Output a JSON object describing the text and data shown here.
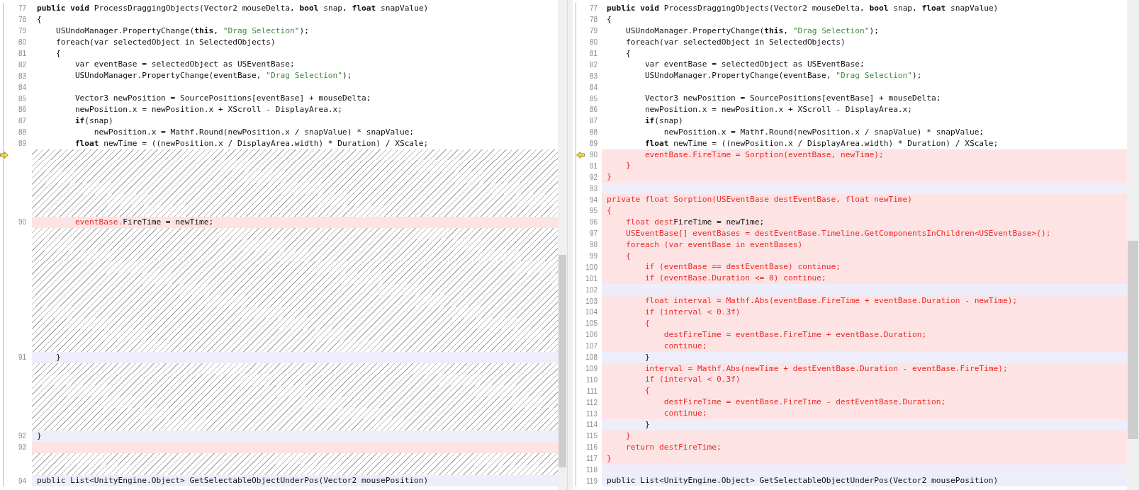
{
  "panes": [
    {
      "rows": [
        {
          "number": "77",
          "kind": "same",
          "current": false,
          "parts": [
            {
              "kind": "keyword",
              "text": "public void"
            },
            {
              "kind": "plain",
              "text": " ProcessDraggingObjects(Vector2 mouseDelta, "
            },
            {
              "kind": "keyword",
              "text": "bool"
            },
            {
              "kind": "plain",
              "text": " snap, "
            },
            {
              "kind": "keyword",
              "text": "float"
            },
            {
              "kind": "plain",
              "text": " snapValue)"
            }
          ]
        },
        {
          "number": "78",
          "kind": "same",
          "current": false,
          "parts": [
            {
              "kind": "plain",
              "text": "{"
            }
          ]
        },
        {
          "number": "79",
          "kind": "same",
          "current": false,
          "parts": [
            {
              "kind": "plain",
              "text": "    USUndoManager.PropertyChange("
            },
            {
              "kind": "keyword",
              "text": "this"
            },
            {
              "kind": "plain",
              "text": ", "
            },
            {
              "kind": "string",
              "text": "\"Drag Selection\""
            },
            {
              "kind": "plain",
              "text": ");"
            }
          ]
        },
        {
          "number": "80",
          "kind": "same",
          "current": false,
          "parts": [
            {
              "kind": "plain",
              "text": "    foreach(var selectedObject in SelectedObjects)"
            }
          ]
        },
        {
          "number": "81",
          "kind": "same",
          "current": false,
          "parts": [
            {
              "kind": "plain",
              "text": "    {"
            }
          ]
        },
        {
          "number": "82",
          "kind": "same",
          "current": false,
          "parts": [
            {
              "kind": "plain",
              "text": "        var eventBase = selectedObject as USEventBase;"
            }
          ]
        },
        {
          "number": "83",
          "kind": "same",
          "current": false,
          "parts": [
            {
              "kind": "plain",
              "text": "        USUndoManager.PropertyChange(eventBase, "
            },
            {
              "kind": "string",
              "text": "\"Drag Selection\""
            },
            {
              "kind": "plain",
              "text": ");"
            }
          ]
        },
        {
          "number": "84",
          "kind": "same",
          "current": false
        },
        {
          "number": "85",
          "kind": "same",
          "current": false,
          "parts": [
            {
              "kind": "plain",
              "text": "        Vector3 newPosition = SourcePositions[eventBase] + mouseDelta;"
            }
          ]
        },
        {
          "number": "86",
          "kind": "same",
          "current": false,
          "parts": [
            {
              "kind": "plain",
              "text": "        newPosition.x = newPosition.x + XScroll - DisplayArea.x;"
            }
          ]
        },
        {
          "number": "87",
          "kind": "same",
          "current": false,
          "parts": [
            {
              "kind": "keyword",
              "text": "        if"
            },
            {
              "kind": "plain",
              "text": "(snap)"
            }
          ]
        },
        {
          "number": "88",
          "kind": "same",
          "current": false,
          "parts": [
            {
              "kind": "plain",
              "text": "            newPosition.x = Mathf.Round(newPosition.x / snapValue) * snapValue;"
            }
          ]
        },
        {
          "number": "89",
          "kind": "same",
          "current": false,
          "parts": [
            {
              "kind": "keyword",
              "text": "        float"
            },
            {
              "kind": "plain",
              "text": " newTime = ((newPosition.x / DisplayArea.width) * Duration) / XScale;"
            }
          ]
        },
        {
          "kind": "filler",
          "current": true
        },
        {
          "kind": "filler",
          "current": false
        },
        {
          "kind": "filler",
          "current": false
        },
        {
          "kind": "filler",
          "current": false
        },
        {
          "kind": "filler",
          "current": false
        },
        {
          "kind": "filler",
          "current": false
        },
        {
          "number": "90",
          "kind": "changed",
          "current": false,
          "parts": [
            {
              "kind": "changed",
              "text": "        eventBase."
            },
            {
              "kind": "plain",
              "text": "FireTime = newTime;"
            }
          ]
        },
        {
          "kind": "filler",
          "current": false
        },
        {
          "kind": "filler",
          "current": false
        },
        {
          "kind": "filler",
          "current": false
        },
        {
          "kind": "filler",
          "current": false
        },
        {
          "kind": "filler",
          "current": false
        },
        {
          "kind": "filler",
          "current": false
        },
        {
          "kind": "filler",
          "current": false
        },
        {
          "kind": "filler",
          "current": false
        },
        {
          "kind": "filler",
          "current": false
        },
        {
          "kind": "filler",
          "current": false
        },
        {
          "kind": "filler",
          "current": false
        },
        {
          "number": "91",
          "kind": "moved",
          "current": false,
          "parts": [
            {
              "kind": "plain",
              "text": "    }"
            }
          ]
        },
        {
          "kind": "filler",
          "current": false
        },
        {
          "kind": "filler",
          "current": false
        },
        {
          "kind": "filler",
          "current": false
        },
        {
          "kind": "filler",
          "current": false
        },
        {
          "kind": "filler",
          "current": false
        },
        {
          "kind": "filler",
          "current": false
        },
        {
          "number": "92",
          "kind": "moved",
          "current": false,
          "parts": [
            {
              "kind": "plain",
              "text": "}"
            }
          ]
        },
        {
          "number": "93",
          "kind": "changed",
          "current": false
        },
        {
          "kind": "filler",
          "current": false
        },
        {
          "kind": "filler",
          "current": false
        },
        {
          "number": "94",
          "kind": "moved",
          "current": false,
          "parts": [
            {
              "kind": "plain",
              "text": "public List<UnityEngine.Object> GetSelectableObjectUnderPos(Vector2 mousePosition)"
            }
          ]
        }
      ]
    },
    {
      "rows": [
        {
          "number": "77",
          "kind": "same",
          "current": false,
          "parts": [
            {
              "kind": "keyword",
              "text": "public void"
            },
            {
              "kind": "plain",
              "text": " ProcessDraggingObjects(Vector2 mouseDelta, "
            },
            {
              "kind": "keyword",
              "text": "bool"
            },
            {
              "kind": "plain",
              "text": " snap, "
            },
            {
              "kind": "keyword",
              "text": "float"
            },
            {
              "kind": "plain",
              "text": " snapValue)"
            }
          ]
        },
        {
          "number": "78",
          "kind": "same",
          "current": false,
          "parts": [
            {
              "kind": "plain",
              "text": "{"
            }
          ]
        },
        {
          "number": "79",
          "kind": "same",
          "current": false,
          "parts": [
            {
              "kind": "plain",
              "text": "    USUndoManager.PropertyChange("
            },
            {
              "kind": "keyword",
              "text": "this"
            },
            {
              "kind": "plain",
              "text": ", "
            },
            {
              "kind": "string",
              "text": "\"Drag Selection\""
            },
            {
              "kind": "plain",
              "text": ");"
            }
          ]
        },
        {
          "number": "80",
          "kind": "same",
          "current": false,
          "parts": [
            {
              "kind": "plain",
              "text": "    foreach(var selectedObject in SelectedObjects)"
            }
          ]
        },
        {
          "number": "81",
          "kind": "same",
          "current": false,
          "parts": [
            {
              "kind": "plain",
              "text": "    {"
            }
          ]
        },
        {
          "number": "82",
          "kind": "same",
          "current": false,
          "parts": [
            {
              "kind": "plain",
              "text": "        var eventBase = selectedObject as USEventBase;"
            }
          ]
        },
        {
          "number": "83",
          "kind": "same",
          "current": false,
          "parts": [
            {
              "kind": "plain",
              "text": "        USUndoManager.PropertyChange(eventBase, "
            },
            {
              "kind": "string",
              "text": "\"Drag Selection\""
            },
            {
              "kind": "plain",
              "text": ");"
            }
          ]
        },
        {
          "number": "84",
          "kind": "same",
          "current": false
        },
        {
          "number": "85",
          "kind": "same",
          "current": false,
          "parts": [
            {
              "kind": "plain",
              "text": "        Vector3 newPosition = SourcePositions[eventBase] + mouseDelta;"
            }
          ]
        },
        {
          "number": "86",
          "kind": "same",
          "current": false,
          "parts": [
            {
              "kind": "plain",
              "text": "        newPosition.x = newPosition.x + XScroll - DisplayArea.x;"
            }
          ]
        },
        {
          "number": "87",
          "kind": "same",
          "current": false,
          "parts": [
            {
              "kind": "keyword",
              "text": "        if"
            },
            {
              "kind": "plain",
              "text": "(snap)"
            }
          ]
        },
        {
          "number": "88",
          "kind": "same",
          "current": false,
          "parts": [
            {
              "kind": "plain",
              "text": "            newPosition.x = Mathf.Round(newPosition.x / snapValue) * snapValue;"
            }
          ]
        },
        {
          "number": "89",
          "kind": "same",
          "current": false,
          "parts": [
            {
              "kind": "keyword",
              "text": "        float"
            },
            {
              "kind": "plain",
              "text": " newTime = ((newPosition.x / DisplayArea.width) * Duration) / XScale;"
            }
          ]
        },
        {
          "number": "90",
          "kind": "changed",
          "current": true,
          "parts": [
            {
              "kind": "changed",
              "text": "        eventBase.FireTime = Sorption(eventBase, newTime);"
            }
          ]
        },
        {
          "number": "91",
          "kind": "changed",
          "current": false,
          "parts": [
            {
              "kind": "changed",
              "text": "    }"
            }
          ]
        },
        {
          "number": "92",
          "kind": "changed",
          "current": false,
          "parts": [
            {
              "kind": "changed",
              "text": "}"
            }
          ]
        },
        {
          "number": "93",
          "kind": "moved",
          "current": false
        },
        {
          "number": "94",
          "kind": "changed",
          "current": false,
          "parts": [
            {
              "kind": "changed",
              "text": "private float Sorption(USEventBase destEventBase, float newTime)"
            }
          ]
        },
        {
          "number": "95",
          "kind": "changed",
          "current": false,
          "parts": [
            {
              "kind": "changed",
              "text": "{"
            }
          ]
        },
        {
          "number": "96",
          "kind": "changed",
          "current": false,
          "parts": [
            {
              "kind": "changed",
              "text": "    float dest"
            },
            {
              "kind": "plain",
              "text": "FireTime = newTime;"
            }
          ]
        },
        {
          "number": "97",
          "kind": "changed",
          "current": false,
          "parts": [
            {
              "kind": "changed",
              "text": "    USEventBase[] eventBases = destEventBase.Timeline.GetComponentsInChildren<USEventBase>();"
            }
          ]
        },
        {
          "number": "98",
          "kind": "changed",
          "current": false,
          "parts": [
            {
              "kind": "changed",
              "text": "    foreach (var eventBase in eventBases)"
            }
          ]
        },
        {
          "number": "99",
          "kind": "changed",
          "current": false,
          "parts": [
            {
              "kind": "changed",
              "text": "    {"
            }
          ]
        },
        {
          "number": "100",
          "kind": "changed",
          "current": false,
          "parts": [
            {
              "kind": "changed",
              "text": "        if (eventBase == destEventBase) continue;"
            }
          ]
        },
        {
          "number": "101",
          "kind": "changed",
          "current": false,
          "parts": [
            {
              "kind": "changed",
              "text": "        if (eventBase.Duration <= 0) continue;"
            }
          ]
        },
        {
          "number": "102",
          "kind": "moved",
          "current": false
        },
        {
          "number": "103",
          "kind": "changed",
          "current": false,
          "parts": [
            {
              "kind": "changed",
              "text": "        float interval = Mathf.Abs(eventBase.FireTime + eventBase.Duration - newTime);"
            }
          ]
        },
        {
          "number": "104",
          "kind": "changed",
          "current": false,
          "parts": [
            {
              "kind": "changed",
              "text": "        if (interval < 0.3f)"
            }
          ]
        },
        {
          "number": "105",
          "kind": "changed",
          "current": false,
          "parts": [
            {
              "kind": "changed",
              "text": "        {"
            }
          ]
        },
        {
          "number": "106",
          "kind": "changed",
          "current": false,
          "parts": [
            {
              "kind": "changed",
              "text": "            destFireTime = eventBase.FireTime + eventBase.Duration;"
            }
          ]
        },
        {
          "number": "107",
          "kind": "changed",
          "current": false,
          "parts": [
            {
              "kind": "changed",
              "text": "            continue;"
            }
          ]
        },
        {
          "number": "108",
          "kind": "moved",
          "current": false,
          "parts": [
            {
              "kind": "plain",
              "text": "        }"
            }
          ]
        },
        {
          "number": "109",
          "kind": "changed",
          "current": false,
          "parts": [
            {
              "kind": "changed",
              "text": "        interval = Mathf.Abs(newTime + destEventBase.Duration - eventBase.FireTime);"
            }
          ]
        },
        {
          "number": "110",
          "kind": "changed",
          "current": false,
          "parts": [
            {
              "kind": "changed",
              "text": "        if (interval < 0.3f)"
            }
          ]
        },
        {
          "number": "111",
          "kind": "changed",
          "current": false,
          "parts": [
            {
              "kind": "changed",
              "text": "        {"
            }
          ]
        },
        {
          "number": "112",
          "kind": "changed",
          "current": false,
          "parts": [
            {
              "kind": "changed",
              "text": "            destFireTime = eventBase.FireTime - destEventBase.Duration;"
            }
          ]
        },
        {
          "number": "113",
          "kind": "changed",
          "current": false,
          "parts": [
            {
              "kind": "changed",
              "text": "            continue;"
            }
          ]
        },
        {
          "number": "114",
          "kind": "moved",
          "current": false,
          "parts": [
            {
              "kind": "plain",
              "text": "        }"
            }
          ]
        },
        {
          "number": "115",
          "kind": "changed",
          "current": false,
          "parts": [
            {
              "kind": "changed",
              "text": "    }"
            }
          ]
        },
        {
          "number": "116",
          "kind": "changed",
          "current": false,
          "parts": [
            {
              "kind": "changed",
              "text": "    return destFireTime;"
            }
          ]
        },
        {
          "number": "117",
          "kind": "changed",
          "current": false,
          "parts": [
            {
              "kind": "changed",
              "text": "}"
            }
          ]
        },
        {
          "number": "118",
          "kind": "moved",
          "current": false
        },
        {
          "number": "119",
          "kind": "moved",
          "current": false,
          "parts": [
            {
              "kind": "plain",
              "text": "public List<UnityEngine.Object> GetSelectableObjectUnderPos(Vector2 mousePosition)"
            }
          ]
        }
      ]
    }
  ]
}
